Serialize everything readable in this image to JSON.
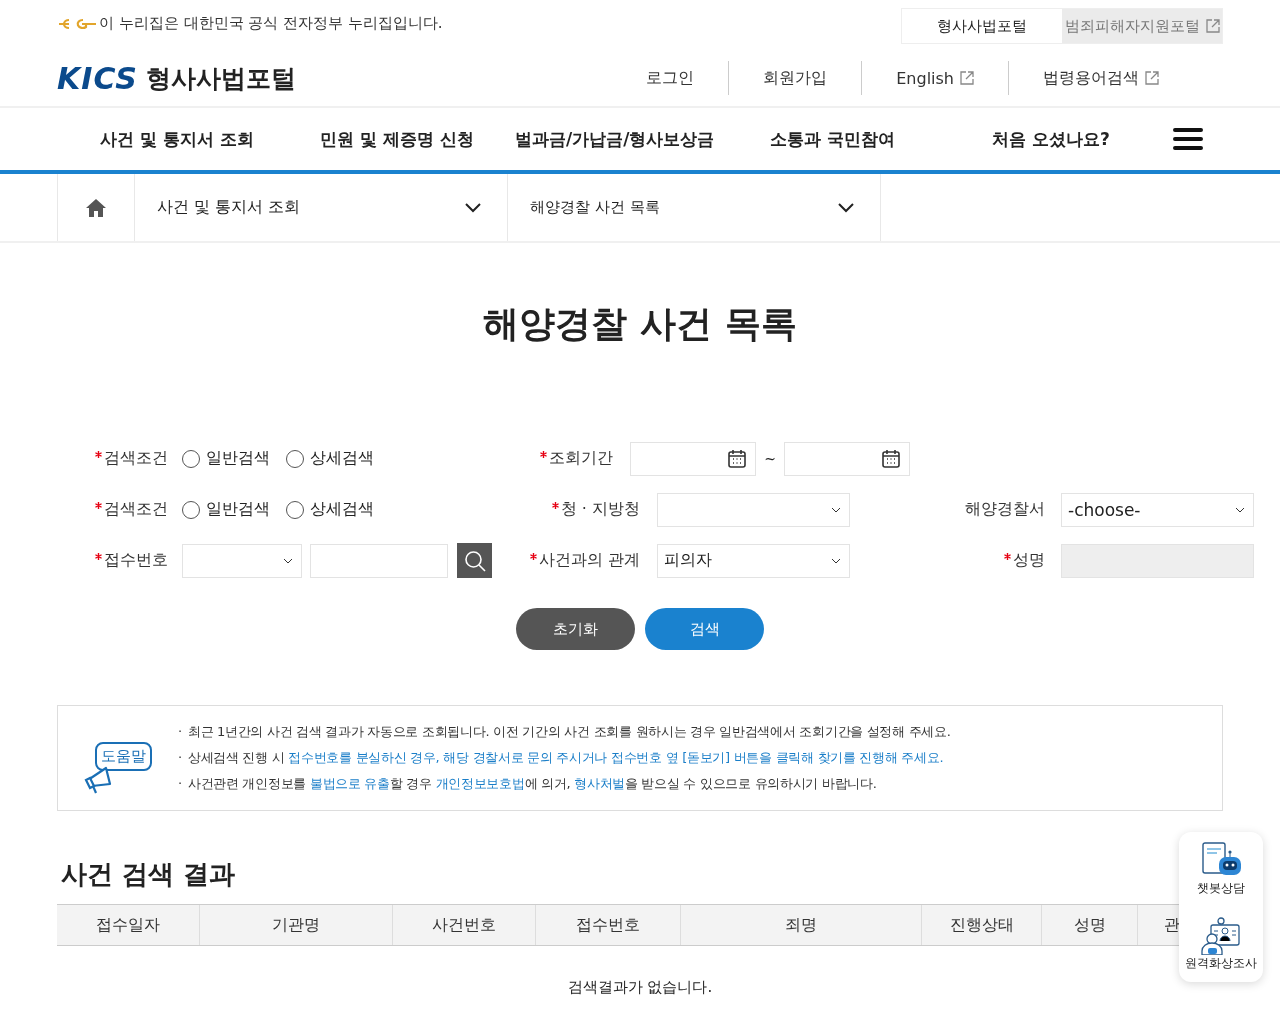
{
  "top_bar": {
    "notice": "이 누리집은 대한민국 공식 전자정부 누리집입니다.",
    "portals": [
      {
        "label": "형사사법포털",
        "selected": true,
        "external": false
      },
      {
        "label": "범죄피해자지원포털",
        "selected": false,
        "external": true
      }
    ]
  },
  "header": {
    "logo": "KICS",
    "site_name": "형사사법포털",
    "links": [
      {
        "label": "로그인",
        "external": false
      },
      {
        "label": "회원가입",
        "external": false
      },
      {
        "label": "English",
        "external": true
      },
      {
        "label": "법령용어검색",
        "external": true
      }
    ]
  },
  "nav": {
    "items": [
      "사건 및 통지서 조회",
      "민원 및 제증명 신청",
      "벌과금/가납금/형사보상금",
      "소통과 국민참여",
      "처음 오셨나요?"
    ]
  },
  "breadcrumb": [
    "사건 및 통지서 조회",
    "해양경찰 사건 목록"
  ],
  "page_title": "해양경찰 사건 목록",
  "form": {
    "rows": [
      {
        "label": "검색조건",
        "required": true,
        "options": [
          {
            "label": "일반검색",
            "selected": false
          },
          {
            "label": "상세검색",
            "selected": false
          }
        ],
        "middle": {
          "label": "조회기간",
          "required": true,
          "kind": "date_range",
          "separator": "~"
        }
      },
      {
        "label": "검색조건",
        "required": true,
        "options": [
          {
            "label": "일반검색",
            "selected": false
          },
          {
            "label": "상세검색",
            "selected": false
          }
        ],
        "middle": {
          "label": "청 · 지방청",
          "required": true,
          "kind": "select"
        },
        "right": {
          "label": "해양경찰서",
          "required": false,
          "kind": "select",
          "value": "-choose-",
          "disabled": false
        }
      },
      {
        "label": "접수번호",
        "required": true,
        "kind": "number_search",
        "middle": {
          "label": "사건과의 관계",
          "required": true,
          "kind": "select",
          "value": "피의자"
        },
        "right": {
          "label": "성명",
          "required": true,
          "kind": "input",
          "disabled": true
        }
      }
    ],
    "buttons": [
      {
        "label": "초기화",
        "kind": "reset"
      },
      {
        "label": "검색",
        "kind": "search"
      }
    ]
  },
  "help": {
    "title": "도움말",
    "bullet": "·",
    "lines": [
      [
        {
          "text": "최근 1년간의 사건 검색 결과가 자동으로 조회됩니다. 이전 기간의 사건 조회를 원하시는 경우 일반검색에서 조회기간을 설정해 주세요.",
          "highlight": false
        }
      ],
      [
        {
          "text": "상세검색 진행 시 ",
          "highlight": false
        },
        {
          "text": "접수번호를 분실하신 경우, 해당 경찰서로 문의 주시거나 접수번호 옆 [돋보기] 버튼을 클릭해 찾기를 진행해 주세요.",
          "highlight": true
        }
      ],
      [
        {
          "text": "사건관련 개인정보를 ",
          "highlight": false
        },
        {
          "text": "불법으로 유출",
          "highlight": true
        },
        {
          "text": "할 경우 ",
          "highlight": false
        },
        {
          "text": "개인정보보호법",
          "highlight": true
        },
        {
          "text": "에 의거, ",
          "highlight": false
        },
        {
          "text": "형사처벌",
          "highlight": true
        },
        {
          "text": "을 받으실 수 있으므로 유의하시기 바랍니다.",
          "highlight": false
        }
      ]
    ]
  },
  "results": {
    "title": "사건 검색 결과",
    "columns": [
      "접수일자",
      "기관명",
      "사건번호",
      "접수번호",
      "죄명",
      "진행상태",
      "성명",
      "관"
    ],
    "empty_message": "검색결과가 없습니다."
  },
  "side_widget": [
    {
      "label": "챗봇상담",
      "kind": "chatbot"
    },
    {
      "label": "원격화상조사",
      "kind": "video"
    }
  ]
}
